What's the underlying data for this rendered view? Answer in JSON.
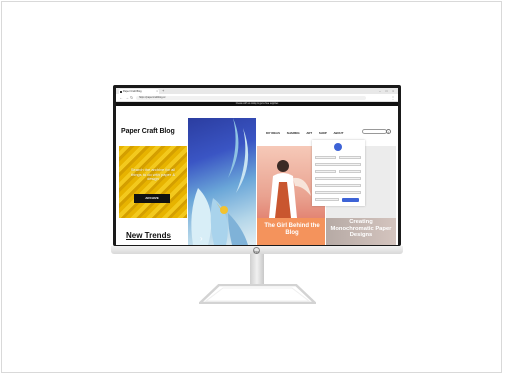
{
  "browser": {
    "tab_title": "Paper Craft Blog",
    "new_tab": "+",
    "url": "https://papercraftblog.cc",
    "window_controls": "–  □  ×",
    "promo_bar": "Create with us today & get a free supplies"
  },
  "site": {
    "logo": "Paper Craft Blog",
    "nav": [
      "DIY IDEAS",
      "SHARING",
      "ART",
      "SHOP",
      "ABOUT"
    ],
    "hero_text": "Search the archive for all things to do with paper & design",
    "archive_button": "ARCHIVE",
    "trends_title": "New Trends",
    "orange_title": "The Girl Behind the Blog",
    "grey_title": "Creating Monochromatic Paper Designs"
  },
  "colors": {
    "accent_blue": "#3d63d6",
    "yellow": "#e7b300",
    "orange": "#f4935c"
  }
}
